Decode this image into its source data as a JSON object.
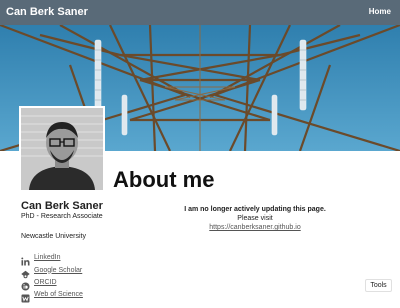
{
  "nav": {
    "site_title": "Can Berk Saner",
    "home_label": "Home"
  },
  "author": {
    "name": "Can Berk Saner",
    "bio": "PhD - Research Associate",
    "location": "Newcastle University",
    "links": [
      {
        "label": "LinkedIn",
        "icon": "linkedin-icon"
      },
      {
        "label": "Google Scholar",
        "icon": "google-scholar-icon"
      },
      {
        "label": "ORCID",
        "icon": "orcid-icon"
      },
      {
        "label": "Web of Science",
        "icon": "web-of-science-icon"
      }
    ]
  },
  "main": {
    "title": "About me",
    "notice_bold": "I am no longer actively updating this page.",
    "notice_text": "Please visit",
    "notice_link": "https://canberksaner.github.io"
  },
  "tools": {
    "label": "Tools"
  },
  "colors": {
    "navbar": "#596a78",
    "sky": "#3a86b0",
    "tower": "#6b4a2a"
  }
}
